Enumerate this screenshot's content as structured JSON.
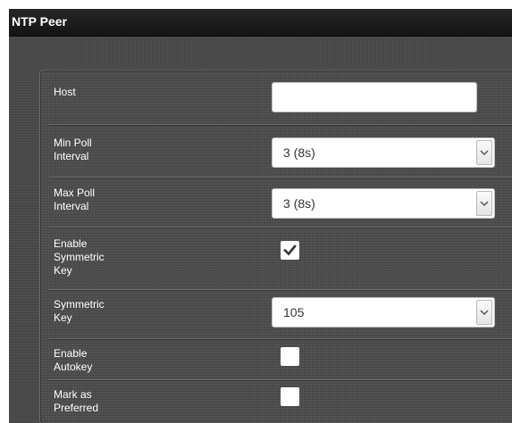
{
  "window": {
    "title": "NTP Peer"
  },
  "form": {
    "host": {
      "label": "Host",
      "value": ""
    },
    "min_poll": {
      "label": "Min Poll\nInterval",
      "value": "3 (8s)"
    },
    "max_poll": {
      "label": "Max Poll\nInterval",
      "value": "3 (8s)"
    },
    "enable_symmetric_key": {
      "label": "Enable\nSymmetric\nKey",
      "checked": true
    },
    "symmetric_key": {
      "label": "Symmetric\nKey",
      "value": "105"
    },
    "enable_autokey": {
      "label": "Enable\nAutokey",
      "checked": false
    },
    "mark_preferred": {
      "label": "Mark as\nPreferred",
      "checked": false
    }
  },
  "icons": {
    "dropdown": "chevron-down-icon",
    "checkmark": "checkmark-icon"
  },
  "colors": {
    "background": "#4a4a4a",
    "titlebar": "#1c1c1c",
    "label_text": "#ffffff",
    "input_bg": "#ffffff"
  }
}
